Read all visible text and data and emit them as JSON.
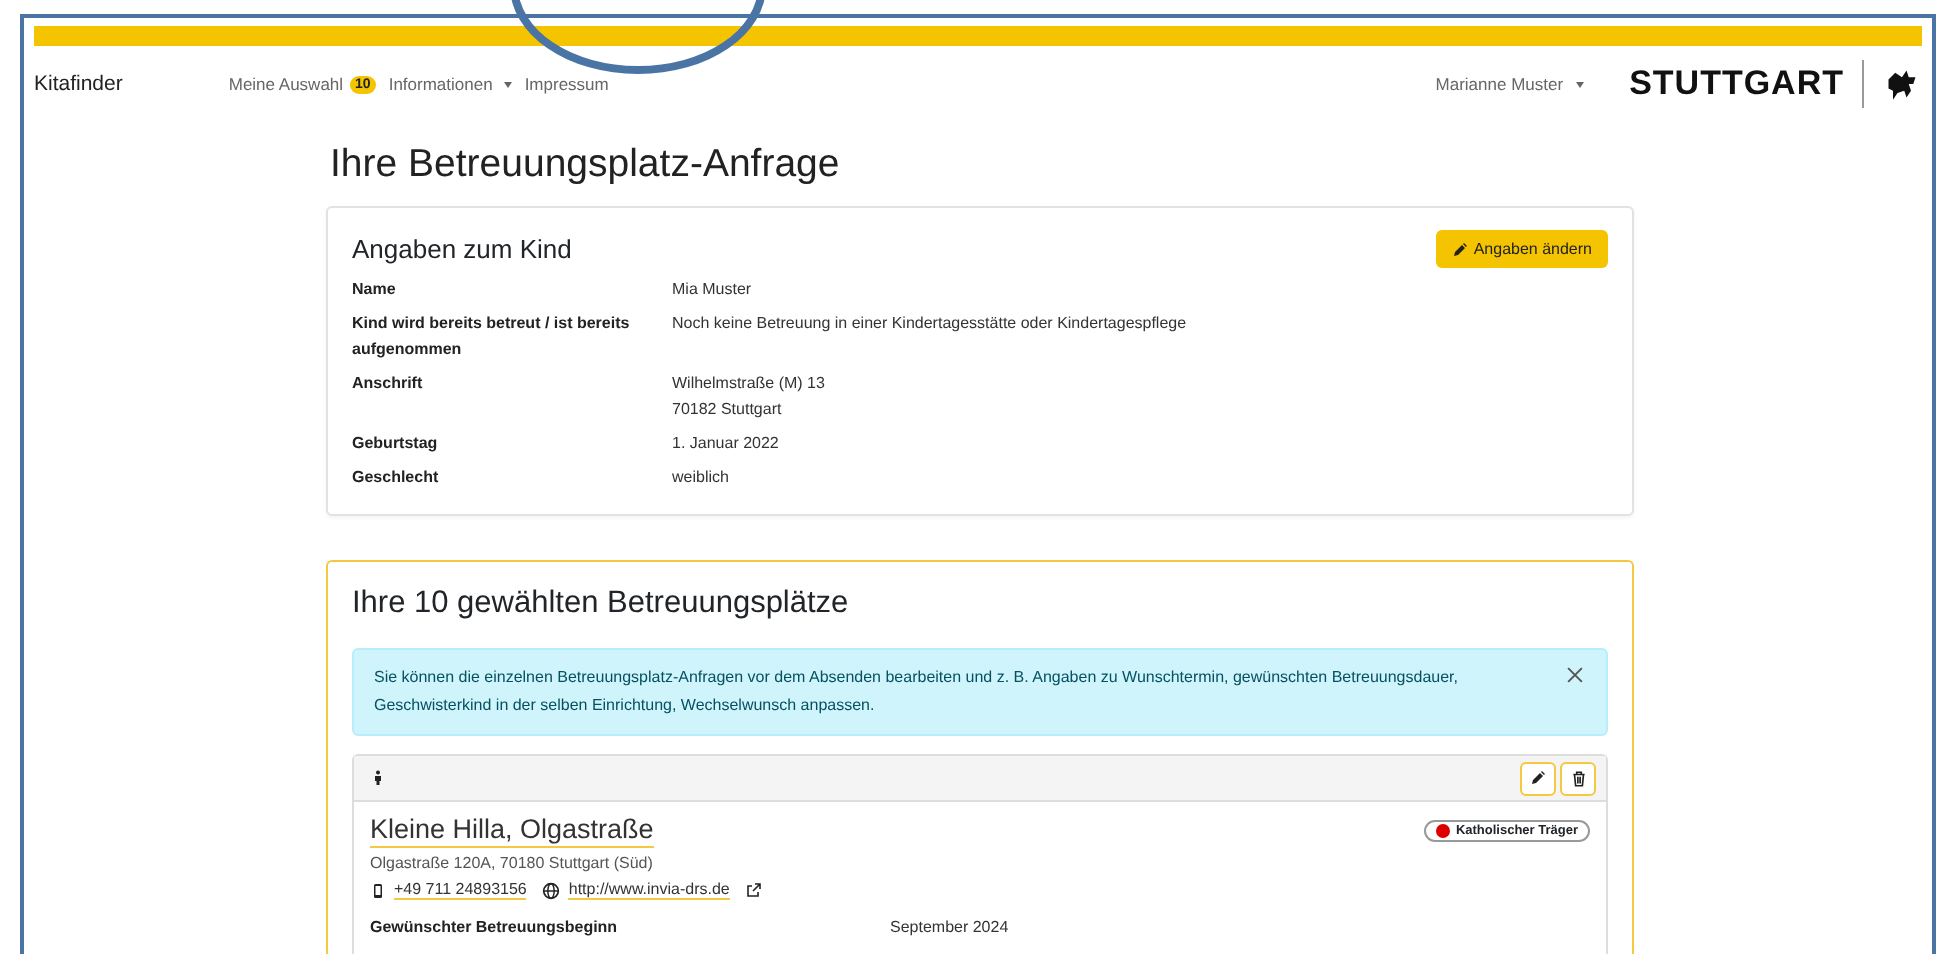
{
  "nav": {
    "brand": "Kitafinder",
    "items": [
      {
        "kind": "badge",
        "label": "Meine Auswahl",
        "badge": "10"
      },
      {
        "kind": "dropdown",
        "label": "Informationen"
      },
      {
        "kind": "link",
        "label": "Impressum"
      }
    ],
    "user": "Marianne Muster",
    "logo": "STUTTGART"
  },
  "page_title": "Ihre Betreuungsplatz-Anfrage",
  "child_card": {
    "title": "Angaben zum Kind",
    "edit_button": "Angaben ändern",
    "fields": [
      {
        "label": "Name",
        "lines": [
          "Mia Muster"
        ]
      },
      {
        "label": "Kind wird bereits betreut / ist bereits aufgenommen",
        "lines": [
          "Noch keine Betreuung in einer Kindertagesstätte oder Kindertagespflege"
        ]
      },
      {
        "label": "Anschrift",
        "lines": [
          "Wilhelmstraße (M) 13",
          "70182 Stuttgart"
        ]
      },
      {
        "label": "Geburtstag",
        "lines": [
          "1. Januar 2022"
        ]
      },
      {
        "label": "Geschlecht",
        "lines": [
          "weiblich"
        ]
      }
    ]
  },
  "places_card": {
    "title": "Ihre 10 gewählten Betreuungsplätze",
    "alert": "Sie können die einzelnen Betreuungsplatz-Anfragen vor dem Absenden bearbeiten und z. B. Angaben zu Wunschtermin, gewünschten Betreuungsdauer, Geschwisterkind in der selben Einrichtung, Wechselwunsch anpassen.",
    "places": [
      {
        "name": "Kleine Hilla, Olgastraße",
        "address": "Olgastraße 120A, 70180 Stuttgart (Süd)",
        "phone": "+49 711 24893156",
        "website": "http://www.invia-drs.de",
        "tag": {
          "label": "Katholischer Träger",
          "color": "#dc0000"
        },
        "fields": [
          {
            "label": "Gewünschter Betreuungsbeginn",
            "value": "September 2024"
          }
        ]
      }
    ]
  }
}
